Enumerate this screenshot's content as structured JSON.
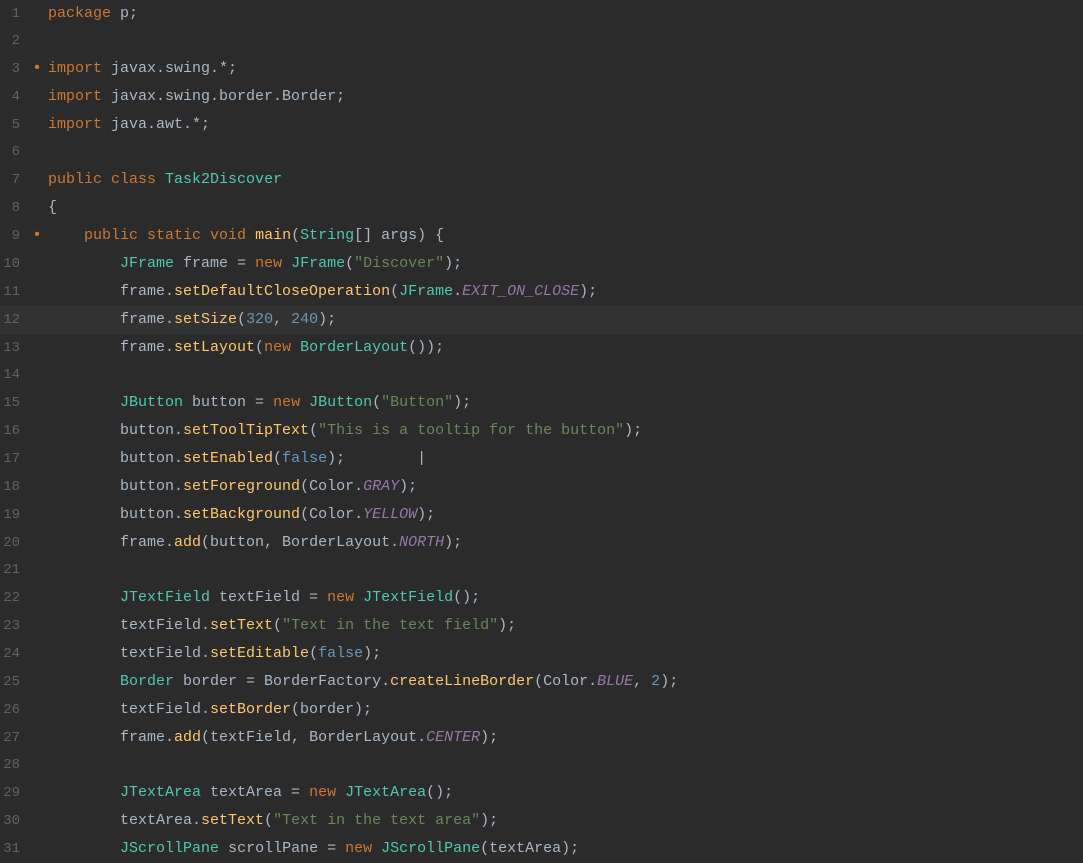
{
  "editor": {
    "background": "#2b2b2b",
    "lines": [
      {
        "num": 1,
        "dot": "",
        "content": "package_p",
        "type": "package"
      },
      {
        "num": 2,
        "dot": "",
        "content": "",
        "type": "empty"
      },
      {
        "num": 3,
        "dot": "•",
        "content": "import_javax_swing",
        "type": "import"
      },
      {
        "num": 4,
        "dot": "",
        "content": "import_javax_swing_border",
        "type": "import"
      },
      {
        "num": 5,
        "dot": "",
        "content": "import_java_awt",
        "type": "import"
      },
      {
        "num": 6,
        "dot": "",
        "content": "",
        "type": "empty"
      },
      {
        "num": 7,
        "dot": "",
        "content": "public_class",
        "type": "class"
      },
      {
        "num": 8,
        "dot": "",
        "content": "{",
        "type": "brace"
      },
      {
        "num": 9,
        "dot": "•",
        "content": "main_method",
        "type": "method"
      },
      {
        "num": 10,
        "dot": "",
        "content": "jframe_new",
        "type": "code"
      },
      {
        "num": 11,
        "dot": "",
        "content": "set_default_close",
        "type": "code"
      },
      {
        "num": 12,
        "dot": "",
        "content": "set_size",
        "type": "code",
        "highlighted": true
      },
      {
        "num": 13,
        "dot": "",
        "content": "set_layout",
        "type": "code"
      },
      {
        "num": 14,
        "dot": "",
        "content": "",
        "type": "empty"
      },
      {
        "num": 15,
        "dot": "",
        "content": "jbutton_new",
        "type": "code"
      },
      {
        "num": 16,
        "dot": "",
        "content": "set_tooltip",
        "type": "code"
      },
      {
        "num": 17,
        "dot": "",
        "content": "set_enabled",
        "type": "code"
      },
      {
        "num": 18,
        "dot": "",
        "content": "set_foreground",
        "type": "code"
      },
      {
        "num": 19,
        "dot": "",
        "content": "set_background",
        "type": "code"
      },
      {
        "num": 20,
        "dot": "",
        "content": "frame_add_button",
        "type": "code"
      },
      {
        "num": 21,
        "dot": "",
        "content": "",
        "type": "empty"
      },
      {
        "num": 22,
        "dot": "",
        "content": "jtextfield_new",
        "type": "code"
      },
      {
        "num": 23,
        "dot": "",
        "content": "set_text_field",
        "type": "code"
      },
      {
        "num": 24,
        "dot": "",
        "content": "set_editable",
        "type": "code"
      },
      {
        "num": 25,
        "dot": "",
        "content": "border_new",
        "type": "code"
      },
      {
        "num": 26,
        "dot": "",
        "content": "set_border",
        "type": "code"
      },
      {
        "num": 27,
        "dot": "",
        "content": "frame_add_textfield",
        "type": "code"
      },
      {
        "num": 28,
        "dot": "",
        "content": "",
        "type": "empty"
      },
      {
        "num": 29,
        "dot": "",
        "content": "jtextarea_new",
        "type": "code"
      },
      {
        "num": 30,
        "dot": "",
        "content": "set_text_area",
        "type": "code"
      },
      {
        "num": 31,
        "dot": "",
        "content": "jscrollpane_new",
        "type": "code"
      }
    ]
  }
}
